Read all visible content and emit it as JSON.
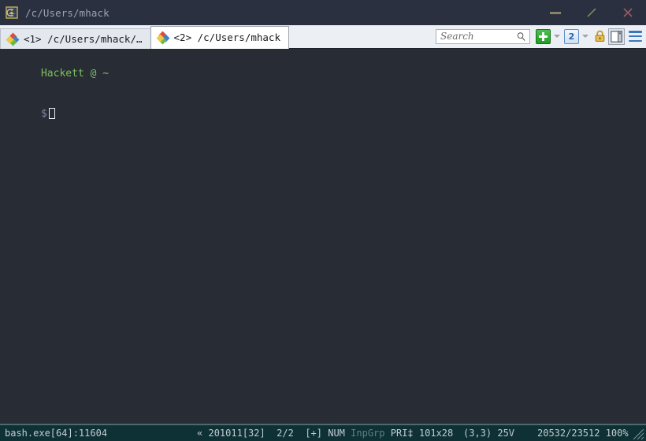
{
  "window": {
    "title": "/c/Users/mhack",
    "app_icon": "conemu-logo-icon",
    "controls": {
      "minimize_label": "Minimize",
      "maximize_label": "Restore",
      "close_label": "Close"
    }
  },
  "tabs": [
    {
      "icon": "bash-diamond-icon",
      "index": "<1>",
      "label": "<1> /c/Users/mhack/…",
      "active": false
    },
    {
      "icon": "bash-diamond-icon",
      "index": "<2>",
      "label": "<2> /c/Users/mhack",
      "active": true
    }
  ],
  "toolbar": {
    "search": {
      "placeholder": "Search",
      "value": ""
    },
    "new_console_label": "+",
    "new_console_caret": "",
    "active_console_label": "2",
    "active_console_caret": "",
    "lock_label": "Lock",
    "split_label": "Split pane",
    "menu_label": "Menu"
  },
  "terminal": {
    "prompt_user_host": "Hackett @ ~",
    "prompt_symbol": "$",
    "input_value": ""
  },
  "statusbar": {
    "process": "bash.exe[64]:11604",
    "arrows": "«",
    "code_page": "201011[32]",
    "tab_counter": "2/2",
    "modified_flag": "[+]",
    "num_lock": "NUM",
    "input_group": "InpGrp",
    "priority": "PRI‡",
    "size": "101x28",
    "cursor_position": "(3,3)",
    "cursor_style": "25V",
    "memory": "20532/23512 100%"
  },
  "colors": {
    "titlebar_bg": "#2b3040",
    "tabbar_bg": "#eceff4",
    "terminal_bg": "#282c34",
    "statusbar_bg": "#0e3136",
    "prompt_green": "#7fbf5f",
    "accent_blue": "#3a76bd",
    "plus_green": "#1e9e20",
    "lock_gold": "#d4a72c"
  }
}
